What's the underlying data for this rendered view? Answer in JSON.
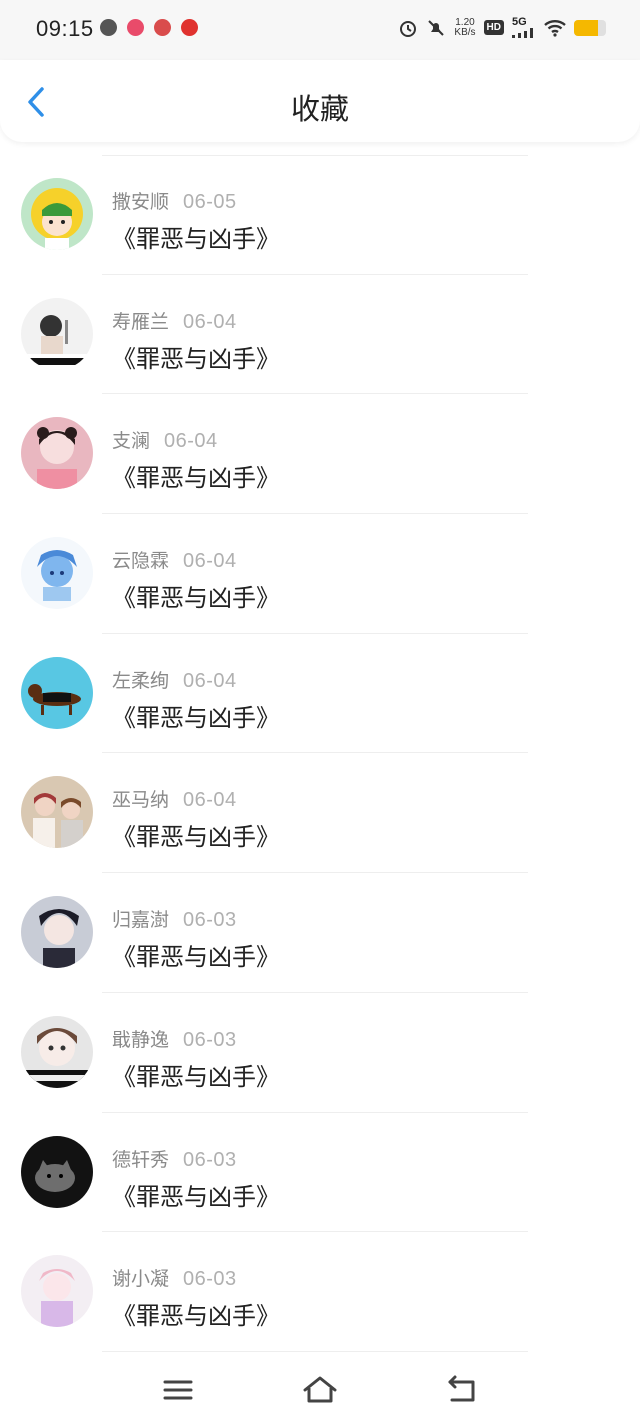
{
  "status_bar": {
    "time": "09:15",
    "net_speed_value": "1.20",
    "net_speed_unit": "KB/s",
    "hd_badge": "HD",
    "network_type": "5G",
    "battery_level": 0.75,
    "colors": {
      "battery": "#f5b800"
    }
  },
  "header": {
    "title": "收藏"
  },
  "accent_color": "#2f8fe8",
  "favorites": [
    {
      "user": "撒安顺",
      "date": "06-05",
      "title": "《罪恶与凶手》"
    },
    {
      "user": "寿雁兰",
      "date": "06-04",
      "title": "《罪恶与凶手》"
    },
    {
      "user": "支澜",
      "date": "06-04",
      "title": "《罪恶与凶手》"
    },
    {
      "user": "云隐霖",
      "date": "06-04",
      "title": "《罪恶与凶手》"
    },
    {
      "user": "左柔绚",
      "date": "06-04",
      "title": "《罪恶与凶手》"
    },
    {
      "user": "巫马纳",
      "date": "06-04",
      "title": "《罪恶与凶手》"
    },
    {
      "user": "归嘉澍",
      "date": "06-03",
      "title": "《罪恶与凶手》"
    },
    {
      "user": "戢静逸",
      "date": "06-03",
      "title": "《罪恶与凶手》"
    },
    {
      "user": "德轩秀",
      "date": "06-03",
      "title": "《罪恶与凶手》"
    },
    {
      "user": "谢小凝",
      "date": "06-03",
      "title": "《罪恶与凶手》"
    }
  ],
  "nav_bar": {
    "icons": [
      "menu-icon",
      "home-icon",
      "back-icon"
    ]
  }
}
